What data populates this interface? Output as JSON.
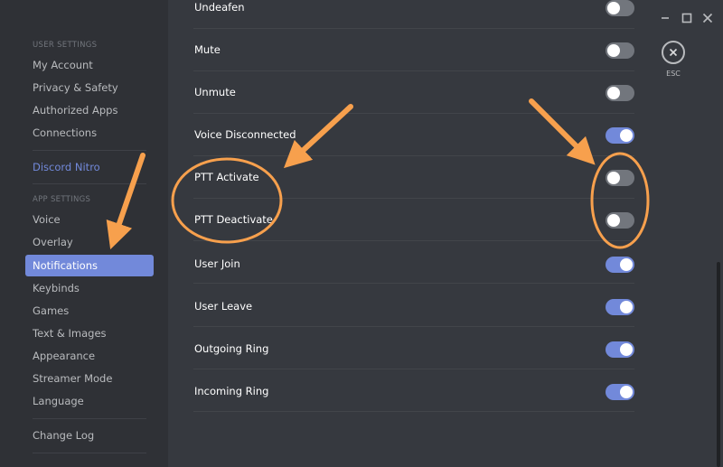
{
  "sidebar": {
    "user_settings_header": "USER SETTINGS",
    "app_settings_header": "APP SETTINGS",
    "user_items": [
      "My Account",
      "Privacy & Safety",
      "Authorized Apps",
      "Connections"
    ],
    "nitro": "Discord Nitro",
    "app_items": [
      "Voice",
      "Overlay",
      "Notifications",
      "Keybinds",
      "Games",
      "Text & Images",
      "Appearance",
      "Streamer Mode",
      "Language"
    ],
    "selected": "Notifications",
    "change_log": "Change Log"
  },
  "notifications": [
    {
      "label": "Undeafen",
      "enabled": false
    },
    {
      "label": "Mute",
      "enabled": false
    },
    {
      "label": "Unmute",
      "enabled": false
    },
    {
      "label": "Voice Disconnected",
      "enabled": true
    },
    {
      "label": "PTT Activate",
      "enabled": false
    },
    {
      "label": "PTT Deactivate",
      "enabled": false
    },
    {
      "label": "User Join",
      "enabled": true
    },
    {
      "label": "User Leave",
      "enabled": true
    },
    {
      "label": "Outgoing Ring",
      "enabled": true
    },
    {
      "label": "Incoming Ring",
      "enabled": true
    }
  ],
  "close": {
    "label": "ESC"
  },
  "colors": {
    "accent": "#7289da",
    "annotation": "#f7a04d"
  }
}
